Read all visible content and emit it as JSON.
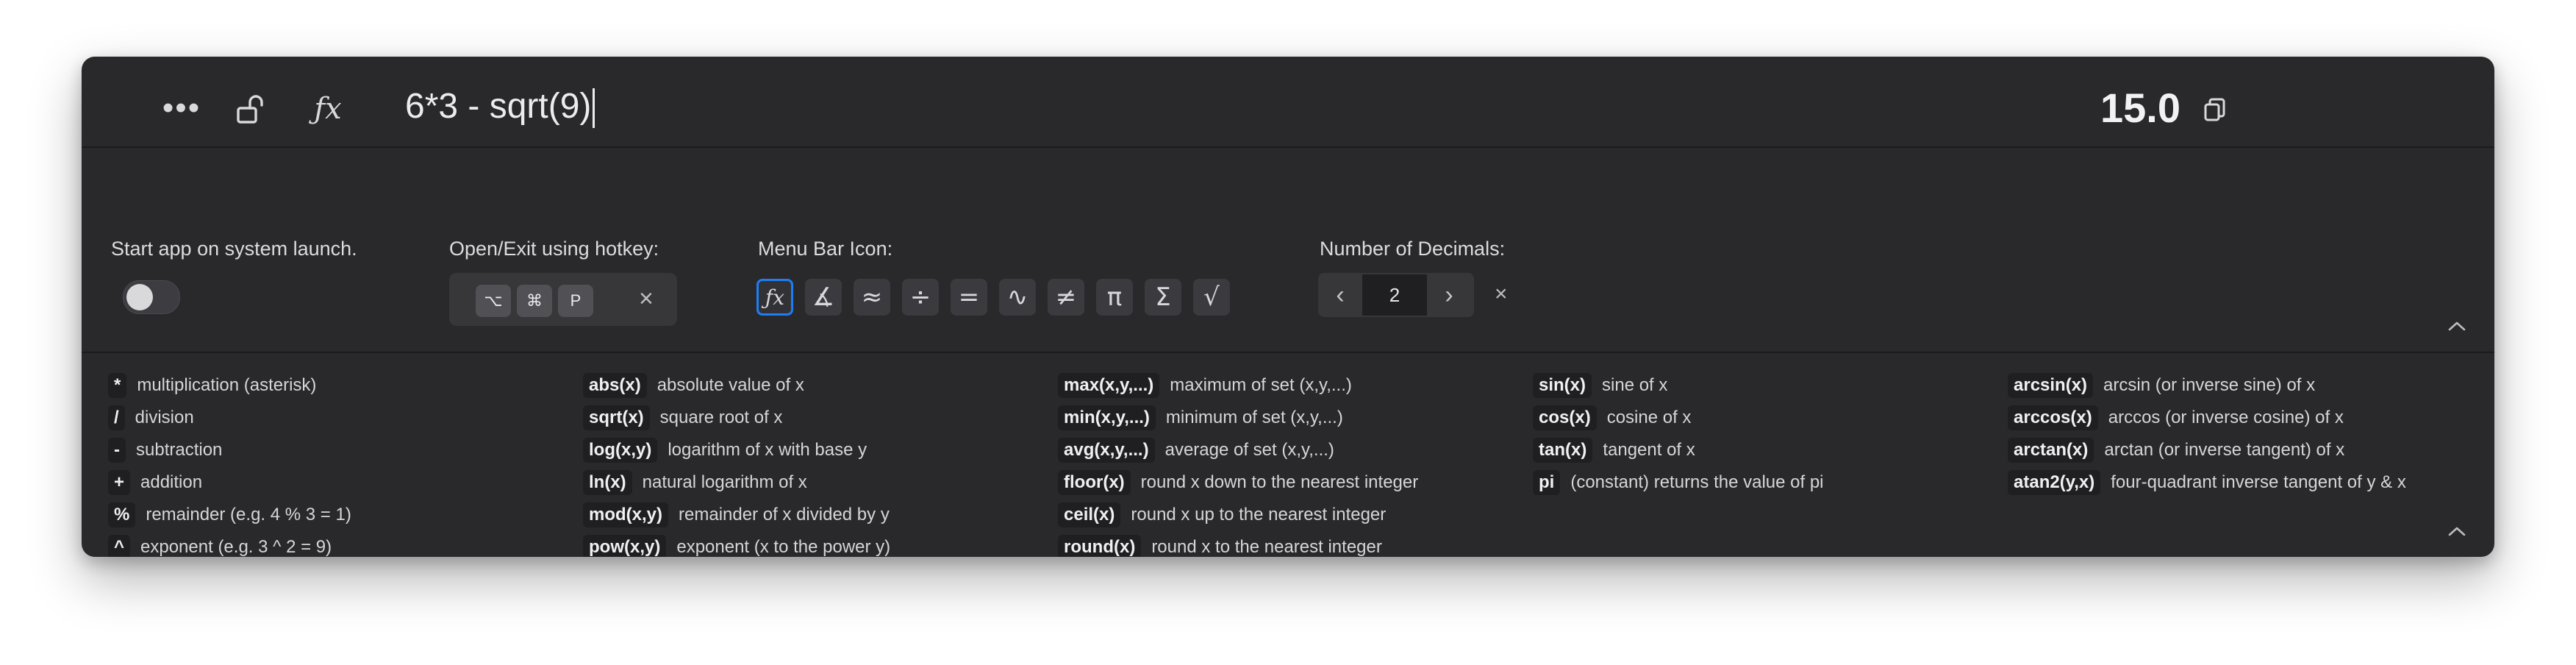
{
  "toolbar": {
    "icons": [
      "more-icon",
      "unlock-icon",
      "fx-icon",
      "copy-icon"
    ],
    "fx_glyph": "ƒx",
    "expression": "6*3 - sqrt(9)",
    "result": "15.0"
  },
  "settings": {
    "launch_label": "Start app on system launch.",
    "launch_enabled": false,
    "hotkey_label": "Open/Exit using hotkey:",
    "hotkey_keys": [
      "⌥",
      "⌘",
      "P"
    ],
    "menubar_label": "Menu Bar Icon:",
    "menubar_icons": [
      {
        "name": "fx-icon",
        "glyph": "ƒx",
        "selected": true
      },
      {
        "name": "angle-icon",
        "glyph": "∡",
        "selected": false
      },
      {
        "name": "approx-icon",
        "glyph": "≈",
        "selected": false
      },
      {
        "name": "divide-icon",
        "glyph": "÷",
        "selected": false
      },
      {
        "name": "equals-icon",
        "glyph": "=",
        "selected": false
      },
      {
        "name": "graph-icon",
        "glyph": "∿",
        "selected": false
      },
      {
        "name": "not-equal-icon",
        "glyph": "≠",
        "selected": false
      },
      {
        "name": "pi-icon",
        "glyph": "π",
        "selected": false
      },
      {
        "name": "sigma-icon",
        "glyph": "Σ",
        "selected": false
      },
      {
        "name": "sqrt-icon",
        "glyph": "√",
        "selected": false
      }
    ],
    "decimals_label": "Number of Decimals:",
    "decimals_value": "2",
    "accent_color": "#1d7ef5"
  },
  "reference": {
    "columns": [
      [
        {
          "tag": "*",
          "desc": "multiplication (asterisk)"
        },
        {
          "tag": "/",
          "desc": "division"
        },
        {
          "tag": "-",
          "desc": "subtraction"
        },
        {
          "tag": "+",
          "desc": "addition"
        },
        {
          "tag": "%",
          "desc": "remainder (e.g. 4 % 3 = 1)"
        },
        {
          "tag": "^",
          "desc": "exponent (e.g. 3 ^ 2 = 9)"
        }
      ],
      [
        {
          "tag": "abs(x)",
          "desc": "absolute value of x"
        },
        {
          "tag": "sqrt(x)",
          "desc": "square root of x"
        },
        {
          "tag": "log(x,y)",
          "desc": "logarithm of x with base y"
        },
        {
          "tag": "ln(x)",
          "desc": "natural logarithm of x"
        },
        {
          "tag": "mod(x,y)",
          "desc": "remainder of x divided by y"
        },
        {
          "tag": "pow(x,y)",
          "desc": "exponent (x to the power y)"
        }
      ],
      [
        {
          "tag": "max(x,y,...)",
          "desc": "maximum of set (x,y,...)"
        },
        {
          "tag": "min(x,y,...)",
          "desc": "minimum of set (x,y,...)"
        },
        {
          "tag": "avg(x,y,...)",
          "desc": "average of set (x,y,...)"
        },
        {
          "tag": "floor(x)",
          "desc": "round x down to the nearest integer"
        },
        {
          "tag": "ceil(x)",
          "desc": "round x up to the nearest integer"
        },
        {
          "tag": "round(x)",
          "desc": "round x to the nearest integer"
        }
      ],
      [
        {
          "tag": "sin(x)",
          "desc": "sine of x"
        },
        {
          "tag": "cos(x)",
          "desc": "cosine of x"
        },
        {
          "tag": "tan(x)",
          "desc": "tangent of x"
        },
        {
          "tag": "pi",
          "desc": "(constant) returns the value of pi"
        }
      ],
      [
        {
          "tag": "arcsin(x)",
          "desc": "arcsin (or inverse sine) of x"
        },
        {
          "tag": "arccos(x)",
          "desc": "arccos (or inverse cosine) of x"
        },
        {
          "tag": "arctan(x)",
          "desc": "arctan (or inverse tangent) of x"
        },
        {
          "tag": "atan2(y,x)",
          "desc": "four-quadrant inverse tangent of y & x"
        }
      ]
    ]
  }
}
